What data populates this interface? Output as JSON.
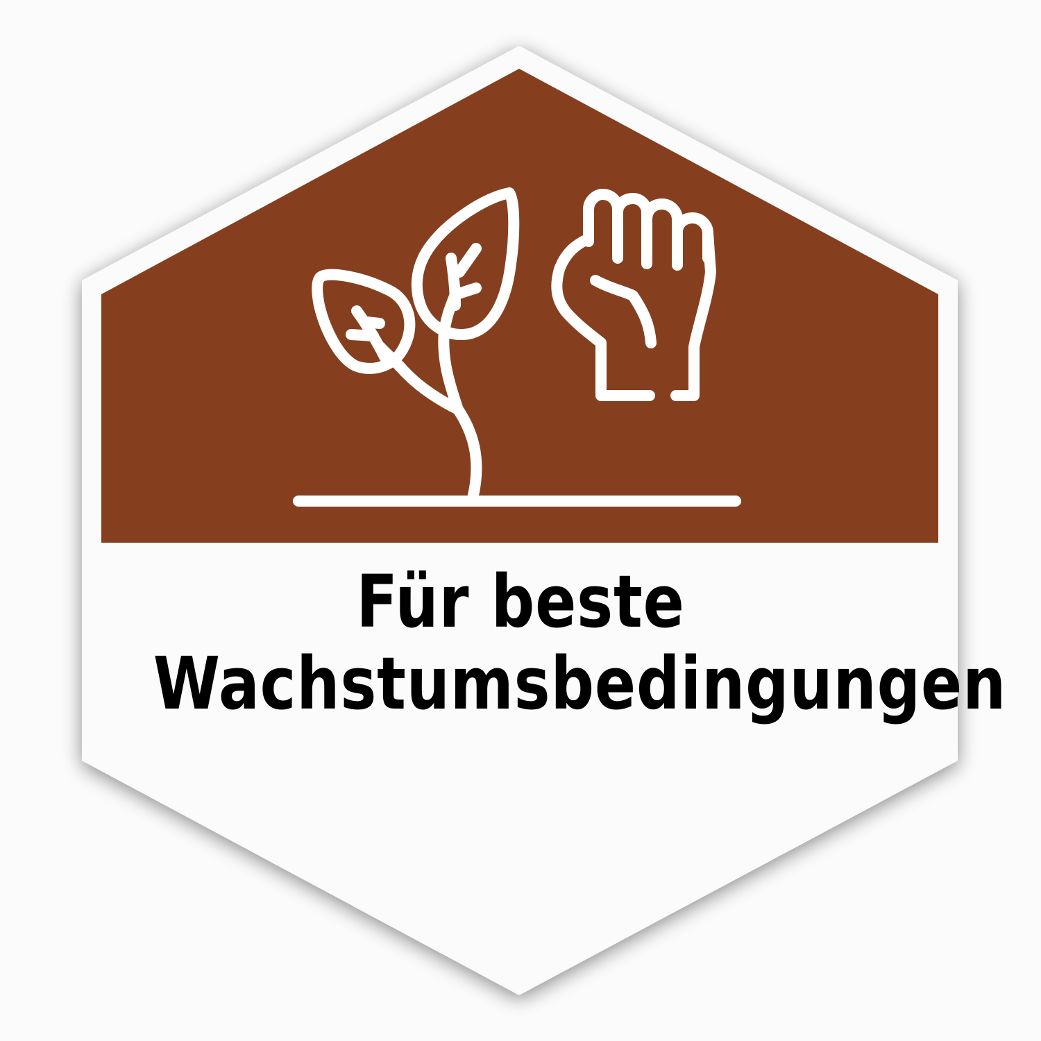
{
  "badge": {
    "line1": "Für beste",
    "line2": "Wachstumsbedingungen",
    "colors": {
      "banner": "#863F1E",
      "background": "#FBFBFB",
      "text": "#000000",
      "icon_stroke": "#FFFFFF"
    },
    "icons": [
      "seedling-icon",
      "raised-fist-icon"
    ]
  }
}
